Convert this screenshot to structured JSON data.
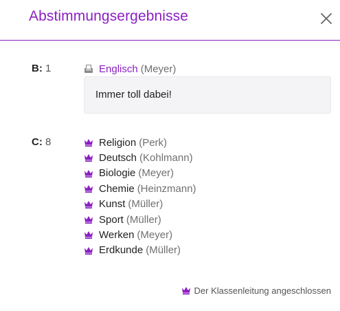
{
  "header": {
    "title": "Abstimmungsergebnisse",
    "close_icon": "close-icon"
  },
  "colors": {
    "accent": "#8a1fc2",
    "divider": "#8a1fc2",
    "comment_bg": "#f4f4f6"
  },
  "group_b": {
    "label": "B:",
    "count": "1",
    "items": [
      {
        "icon": "ballot-icon",
        "subject": "Englisch",
        "teacher": "(Meyer)"
      }
    ],
    "comment": "Immer toll dabei!"
  },
  "group_c": {
    "label": "C:",
    "count": "8",
    "items": [
      {
        "icon": "crown-icon",
        "subject": "Religion",
        "teacher": "(Perk)"
      },
      {
        "icon": "crown-icon",
        "subject": "Deutsch",
        "teacher": "(Kohlmann)"
      },
      {
        "icon": "crown-icon",
        "subject": "Biologie",
        "teacher": "(Meyer)"
      },
      {
        "icon": "crown-icon",
        "subject": "Chemie",
        "teacher": "(Heinzmann)"
      },
      {
        "icon": "crown-icon",
        "subject": "Kunst",
        "teacher": "(Müller)"
      },
      {
        "icon": "crown-icon",
        "subject": "Sport",
        "teacher": "(Müller)"
      },
      {
        "icon": "crown-icon",
        "subject": "Werken",
        "teacher": "(Meyer)"
      },
      {
        "icon": "crown-icon",
        "subject": "Erdkunde",
        "teacher": "(Müller)"
      }
    ]
  },
  "footer": {
    "legend_icon": "crown-icon",
    "text": "Der Klassenleitung angeschlossen"
  }
}
